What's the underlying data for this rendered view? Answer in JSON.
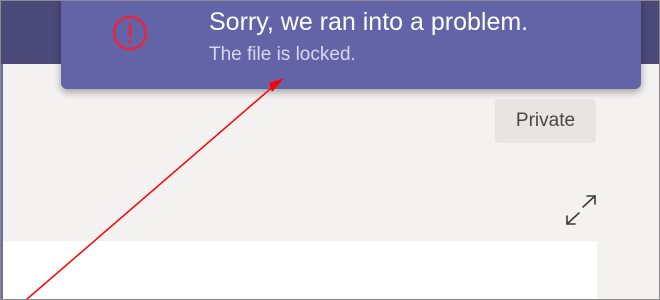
{
  "toast": {
    "icon": "alert-circle-icon",
    "title": "Sorry, we ran into a problem.",
    "subtitle": "The file is locked."
  },
  "badge": {
    "label": "Private"
  },
  "icons": {
    "expand": "expand-diagonal-icon"
  },
  "colors": {
    "toast_background": "#6264a7",
    "error_icon": "#e8263d",
    "arrow": "#ff0000",
    "header_band": "#4b4a78"
  }
}
